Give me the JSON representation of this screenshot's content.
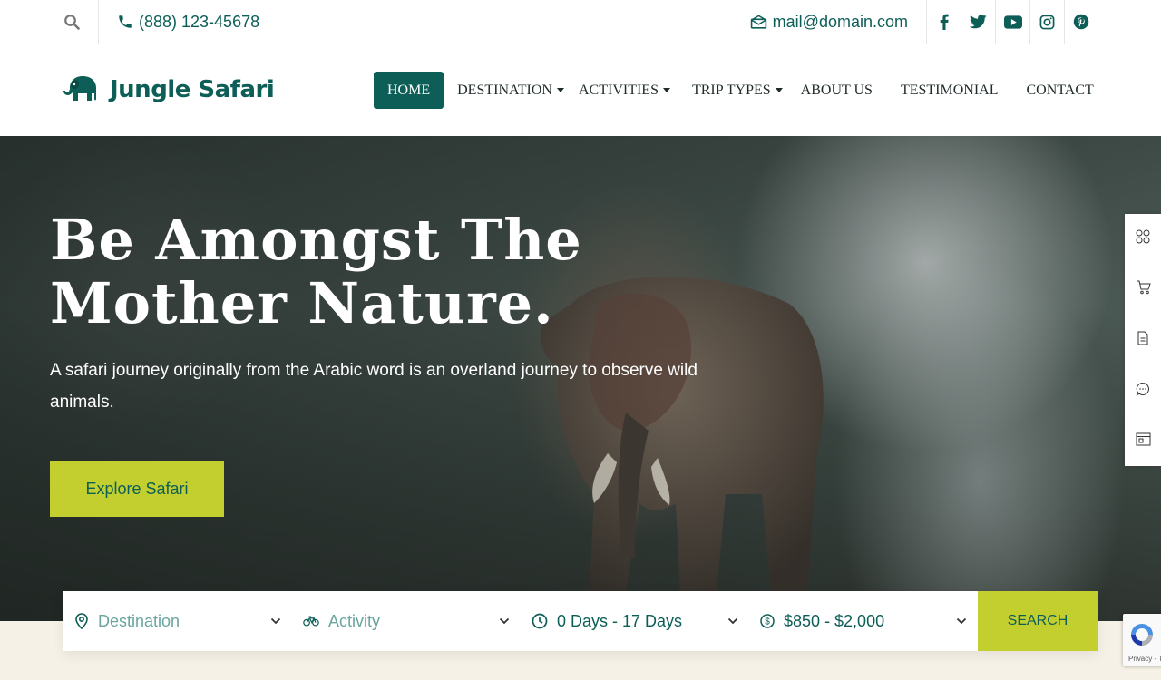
{
  "topbar": {
    "phone": "(888) 123-45678",
    "email": "mail@domain.com",
    "social": [
      "facebook-icon",
      "twitter-icon",
      "youtube-icon",
      "instagram-icon",
      "pinterest-icon"
    ]
  },
  "brand": {
    "name": "Jungle Safari",
    "color": "#0d5e57",
    "accent": "#c3cf2e"
  },
  "nav": {
    "home": "HOME",
    "destination": "DESTINATION",
    "activities": "ACTIVITIES",
    "trip_types": "TRIP TYPES",
    "about": "ABOUT US",
    "testimonial": "TESTIMONIAL",
    "contact": "CONTACT"
  },
  "hero": {
    "title": "Be Amongst The Mother Nature.",
    "subtitle": "A safari journey originally from the Arabic word is an overland journey to observe wild animals.",
    "cta": "Explore Safari"
  },
  "search": {
    "destination": "Destination",
    "activity": "Activity",
    "duration": "0 Days - 17 Days",
    "price": "$850 - $2,000",
    "button": "SEARCH"
  },
  "recaptcha": {
    "text": "Privacy - Terms"
  }
}
